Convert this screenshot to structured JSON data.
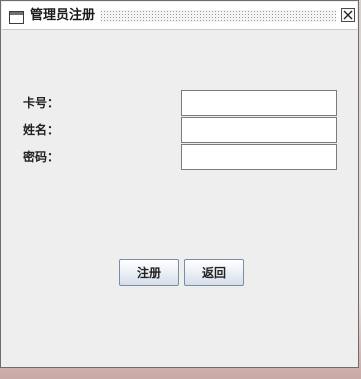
{
  "window": {
    "title": "管理员注册",
    "icon": "window-icon",
    "close_icon": "close-icon"
  },
  "form": {
    "fields": [
      {
        "label": "卡号：",
        "value": "",
        "placeholder": ""
      },
      {
        "label": "姓名：",
        "value": "",
        "placeholder": ""
      },
      {
        "label": "密码：",
        "value": "",
        "placeholder": ""
      }
    ]
  },
  "buttons": {
    "register_label": "注册",
    "back_label": "返回"
  },
  "colors": {
    "window_bg": "#eeeeee",
    "button_border": "#7a8ea3"
  }
}
